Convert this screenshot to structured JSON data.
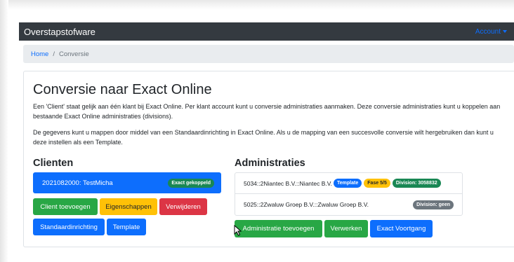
{
  "navbar": {
    "brand": "Overstapstofware",
    "account_label": "Account"
  },
  "breadcrumb": {
    "home": "Home",
    "separator": "/",
    "current": "Conversie"
  },
  "main": {
    "title": "Conversie naar Exact Online",
    "paragraph1": "Een 'Client' staat gelijk aan één klant bij Exact Online. Per klant account kunt u conversie administraties aanmaken. Deze conversie administraties kunt u koppelen aan bestaande Exact Online administraties (divisions).",
    "paragraph2": "De gegevens kunt u mappen door middel van een Standaardinrichting in Exact Online. Als u de mapping van een succesvolle conversie wilt hergebruiken dan kunt u deze instellen als een Template."
  },
  "clienten": {
    "heading": "Clienten",
    "items": [
      {
        "label": "2021082000: TestMicha",
        "badge": "Exact gekoppeld"
      }
    ],
    "buttons": {
      "add": "Client toevoegen",
      "properties": "Eigenschappen",
      "delete": "Verwijderen",
      "standard": "Standaardinrichting",
      "template": "Template"
    }
  },
  "administraties": {
    "heading": "Administraties",
    "items": [
      {
        "label": "5034::2Niantec B.V.::Niantec B.V.",
        "badges": [
          "Template",
          "Fase 5/5",
          "Division: 3058832"
        ]
      },
      {
        "label": "5025::2Zwaluw Groep B.V.::Zwaluw Groep B.V.",
        "badges": [
          "Division: geen"
        ]
      }
    ],
    "buttons": {
      "add": "Administratie toevoegen",
      "process": "Verwerken",
      "progress": "Exact Voortgang"
    }
  },
  "colors": {
    "navbar": "#343a40",
    "primary": "#0d6efd",
    "success": "#28a745",
    "warning": "#ffc107",
    "danger": "#dc3545",
    "secondary": "#6c757d"
  }
}
